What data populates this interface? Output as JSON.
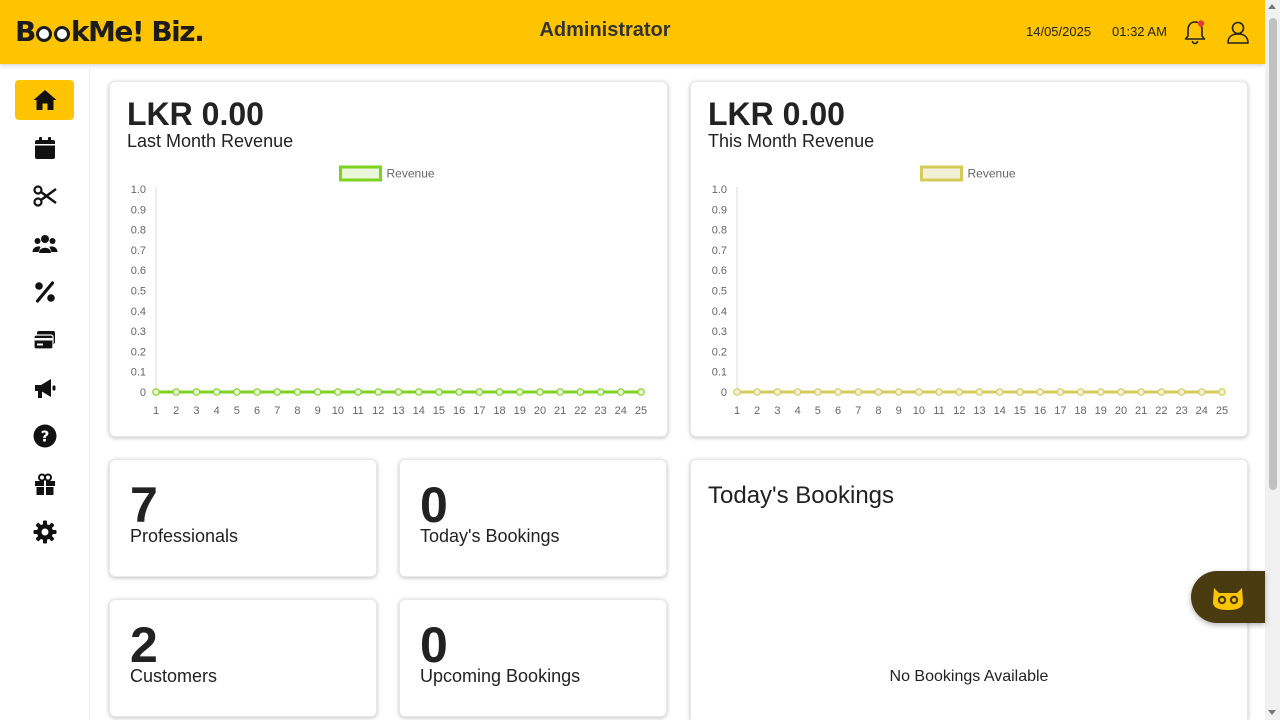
{
  "header": {
    "logo": "BookMe! Biz.",
    "title": "Administrator",
    "date": "14/05/2025",
    "time": "01:32 AM"
  },
  "sidebar": {
    "items": [
      {
        "icon": "home-icon",
        "active": true
      },
      {
        "icon": "calendar-icon"
      },
      {
        "icon": "scissors-icon"
      },
      {
        "icon": "users-icon"
      },
      {
        "icon": "percent-icon"
      },
      {
        "icon": "card-icon"
      },
      {
        "icon": "megaphone-icon"
      },
      {
        "icon": "help-icon"
      },
      {
        "icon": "gift-icon"
      },
      {
        "icon": "gear-icon"
      }
    ]
  },
  "cards": {
    "last_month": {
      "amount": "LKR 0.00",
      "label": "Last Month Revenue"
    },
    "this_month": {
      "amount": "LKR 0.00",
      "label": "This Month Revenue"
    },
    "professionals": {
      "value": "7",
      "label": "Professionals"
    },
    "todays_bookings_count": {
      "value": "0",
      "label": "Today's Bookings"
    },
    "customers": {
      "value": "2",
      "label": "Customers"
    },
    "upcoming_bookings": {
      "value": "0",
      "label": "Upcoming Bookings"
    },
    "todays_bookings": {
      "title": "Today's Bookings",
      "empty": "No Bookings Available"
    }
  },
  "colors": {
    "accent": "#ffc400",
    "last_month_line": "#7ed321",
    "this_month_line": "#d4cc5a"
  },
  "chart_data": [
    {
      "type": "line",
      "x": [
        "1",
        "2",
        "3",
        "4",
        "5",
        "6",
        "7",
        "8",
        "9",
        "10",
        "11",
        "12",
        "13",
        "14",
        "15",
        "16",
        "17",
        "18",
        "19",
        "20",
        "21",
        "22",
        "23",
        "24",
        "25"
      ],
      "series": [
        {
          "name": "Revenue",
          "values": [
            0,
            0,
            0,
            0,
            0,
            0,
            0,
            0,
            0,
            0,
            0,
            0,
            0,
            0,
            0,
            0,
            0,
            0,
            0,
            0,
            0,
            0,
            0,
            0,
            0
          ]
        }
      ],
      "yticks": [
        "0",
        "0.1",
        "0.2",
        "0.3",
        "0.4",
        "0.5",
        "0.6",
        "0.7",
        "0.8",
        "0.9",
        "1.0"
      ],
      "ylim": [
        0,
        1
      ],
      "legend": "top-center"
    },
    {
      "type": "line",
      "x": [
        "1",
        "2",
        "3",
        "4",
        "5",
        "6",
        "7",
        "8",
        "9",
        "10",
        "11",
        "12",
        "13",
        "14",
        "15",
        "16",
        "17",
        "18",
        "19",
        "20",
        "21",
        "22",
        "23",
        "24",
        "25"
      ],
      "series": [
        {
          "name": "Revenue",
          "values": [
            0,
            0,
            0,
            0,
            0,
            0,
            0,
            0,
            0,
            0,
            0,
            0,
            0,
            0,
            0,
            0,
            0,
            0,
            0,
            0,
            0,
            0,
            0,
            0,
            0
          ]
        }
      ],
      "yticks": [
        "0",
        "0.1",
        "0.2",
        "0.3",
        "0.4",
        "0.5",
        "0.6",
        "0.7",
        "0.8",
        "0.9",
        "1.0"
      ],
      "ylim": [
        0,
        1
      ],
      "legend": "top-center"
    }
  ]
}
